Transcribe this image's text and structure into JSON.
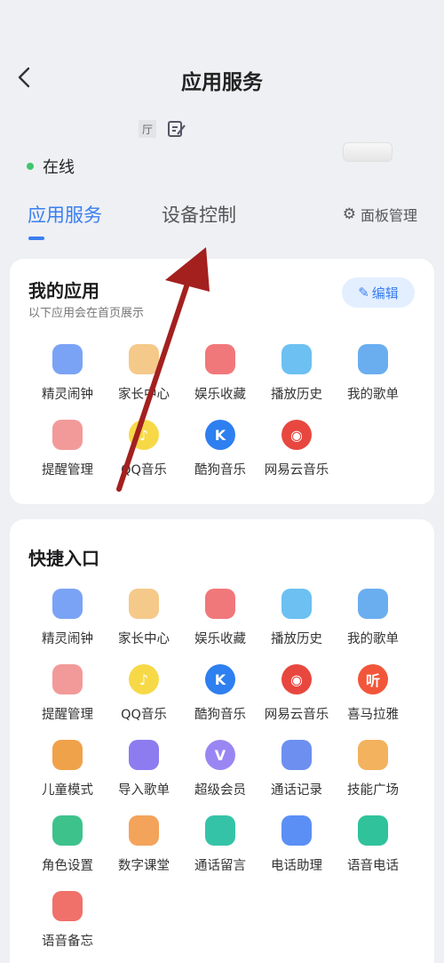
{
  "header": {
    "title": "应用服务"
  },
  "device": {
    "name_chip_text": "厅",
    "status_text": "在线",
    "status_color": "#3fc66d"
  },
  "tabs": {
    "items": [
      {
        "label": "应用服务"
      },
      {
        "label": "设备控制"
      }
    ],
    "panel_label": "面板管理",
    "active_color": "#3a7ef0"
  },
  "my_apps": {
    "title": "我的应用",
    "subtitle": "以下应用会在首页展示",
    "edit_label": "编辑",
    "items": [
      {
        "label": "精灵闹钟",
        "icon": "alarm-clock-icon",
        "color": "#7aa3f5"
      },
      {
        "label": "家长中心",
        "icon": "parent-face-icon",
        "color": "#f5c98a"
      },
      {
        "label": "娱乐收藏",
        "icon": "favorite-folder-icon",
        "color": "#f0787a"
      },
      {
        "label": "播放历史",
        "icon": "history-icon",
        "color": "#6cc0f2"
      },
      {
        "label": "我的歌单",
        "icon": "playlist-icon",
        "color": "#6aaef0"
      },
      {
        "label": "提醒管理",
        "icon": "bell-icon",
        "color": "#f29a9a"
      },
      {
        "label": "QQ音乐",
        "icon": "qq-music-icon",
        "color": "#f7d948",
        "glyph": "♪"
      },
      {
        "label": "酷狗音乐",
        "icon": "kugou-icon",
        "color": "#2e7ff0",
        "glyph": "K"
      },
      {
        "label": "网易云音乐",
        "icon": "netease-icon",
        "color": "#e8473f",
        "glyph": "◉"
      }
    ]
  },
  "shortcuts": {
    "title": "快捷入口",
    "items": [
      {
        "label": "精灵闹钟",
        "icon": "alarm-clock-icon",
        "color": "#7aa3f5"
      },
      {
        "label": "家长中心",
        "icon": "parent-face-icon",
        "color": "#f5c98a"
      },
      {
        "label": "娱乐收藏",
        "icon": "favorite-folder-icon",
        "color": "#f0787a"
      },
      {
        "label": "播放历史",
        "icon": "history-icon",
        "color": "#6cc0f2"
      },
      {
        "label": "我的歌单",
        "icon": "playlist-icon",
        "color": "#6aaef0"
      },
      {
        "label": "提醒管理",
        "icon": "bell-icon",
        "color": "#f29a9a"
      },
      {
        "label": "QQ音乐",
        "icon": "qq-music-icon",
        "color": "#f7d948",
        "glyph": "♪"
      },
      {
        "label": "酷狗音乐",
        "icon": "kugou-icon",
        "color": "#2e7ff0",
        "glyph": "K"
      },
      {
        "label": "网易云音乐",
        "icon": "netease-icon",
        "color": "#e8473f",
        "glyph": "◉"
      },
      {
        "label": "喜马拉雅",
        "icon": "ximalaya-icon",
        "color": "#f2563a",
        "glyph": "听"
      },
      {
        "label": "儿童模式",
        "icon": "rocking-horse-icon",
        "color": "#f0a24a"
      },
      {
        "label": "导入歌单",
        "icon": "import-playlist-icon",
        "color": "#8c7cf0"
      },
      {
        "label": "超级会员",
        "icon": "vip-heart-icon",
        "color": "#9a86f2",
        "glyph": "V"
      },
      {
        "label": "通话记录",
        "icon": "call-log-icon",
        "color": "#6c8ff0"
      },
      {
        "label": "技能广场",
        "icon": "planet-icon",
        "color": "#f2b25e"
      },
      {
        "label": "角色设置",
        "icon": "role-user-icon",
        "color": "#3ec28c"
      },
      {
        "label": "数字课堂",
        "icon": "video-class-icon",
        "color": "#f4a35a"
      },
      {
        "label": "通话留言",
        "icon": "voice-message-icon",
        "color": "#35c3a8"
      },
      {
        "label": "电话助理",
        "icon": "robot-icon",
        "color": "#5b8ff5"
      },
      {
        "label": "语音电话",
        "icon": "voice-call-icon",
        "color": "#2fc29b"
      },
      {
        "label": "语音备忘",
        "icon": "voice-memo-icon",
        "color": "#f0706a"
      }
    ]
  }
}
